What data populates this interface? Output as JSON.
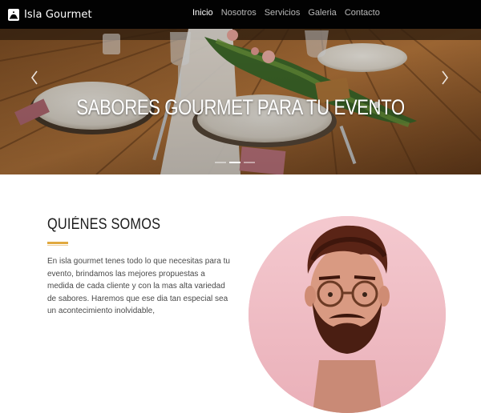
{
  "brand": {
    "name": "Isla Gourmet",
    "logo_icon": "bell-cloche-icon"
  },
  "nav": {
    "items": [
      {
        "label": "Inicio",
        "active": true
      },
      {
        "label": "Nosotros",
        "active": false
      },
      {
        "label": "Servicios",
        "active": false
      },
      {
        "label": "Galeria",
        "active": false
      },
      {
        "label": "Contacto",
        "active": false
      }
    ]
  },
  "hero": {
    "title": "SABORES GOURMET PARA TU EVENTO",
    "prev_icon": "chevron-left-icon",
    "next_icon": "chevron-right-icon",
    "slides_count": 3,
    "active_slide": 1
  },
  "about": {
    "title": "QUIÉNES SOMOS",
    "text": "En isla gourmet tenes todo lo que necesitas para tu evento, brindamos las mejores propuestas a medida de cada cliente y con la mas alta variedad de sabores. Haremos que ese dia tan especial sea un acontecimiento inolvidable,"
  },
  "colors": {
    "navbar_bg": "#020202",
    "accent": "#e0a93f",
    "portrait_bg": "#f2c0c8"
  }
}
